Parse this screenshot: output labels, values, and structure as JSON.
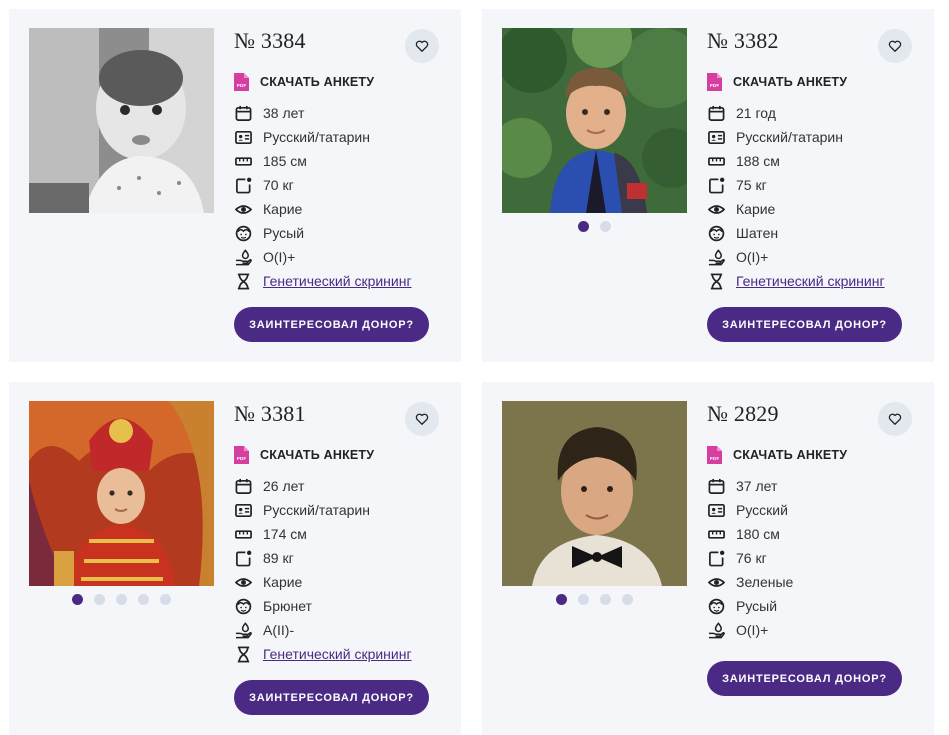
{
  "download_label": "СКАЧАТЬ АНКЕТУ",
  "cta_label": "ЗАИНТЕРЕСОВАЛ ДОНОР?",
  "colors": {
    "accent": "#4a2a84",
    "card_bg": "#f4f6f9",
    "pdf": "#d63fa0"
  },
  "cards": [
    {
      "number": "№ 3384",
      "attrs": [
        "38 лет",
        "Русский/татарин",
        "185 см",
        "70 кг",
        "Карие",
        "Русый",
        "O(I)+"
      ],
      "screening": "Генетический скрининг",
      "photo_dots": 0,
      "active_dot": 0
    },
    {
      "number": "№ 3382",
      "attrs": [
        "21 год",
        "Русский/татарин",
        "188 см",
        "75 кг",
        "Карие",
        "Шатен",
        "O(I)+"
      ],
      "screening": "Генетический скрининг",
      "photo_dots": 2,
      "active_dot": 0
    },
    {
      "number": "№ 3381",
      "attrs": [
        "26 лет",
        "Русский/татарин",
        "174 см",
        "89 кг",
        "Карие",
        "Брюнет",
        "A(II)-"
      ],
      "screening": "Генетический скрининг",
      "photo_dots": 5,
      "active_dot": 0
    },
    {
      "number": "№ 2829",
      "attrs": [
        "37 лет",
        "Русский",
        "180 см",
        "76 кг",
        "Зеленые",
        "Русый",
        "O(I)+"
      ],
      "screening": "",
      "photo_dots": 4,
      "active_dot": 0
    }
  ],
  "attr_icons": [
    "calendar-icon",
    "id-card-icon",
    "ruler-icon",
    "weight-icon",
    "eye-icon",
    "hair-icon",
    "blood-type-icon"
  ],
  "screening_icon": "dna-icon"
}
